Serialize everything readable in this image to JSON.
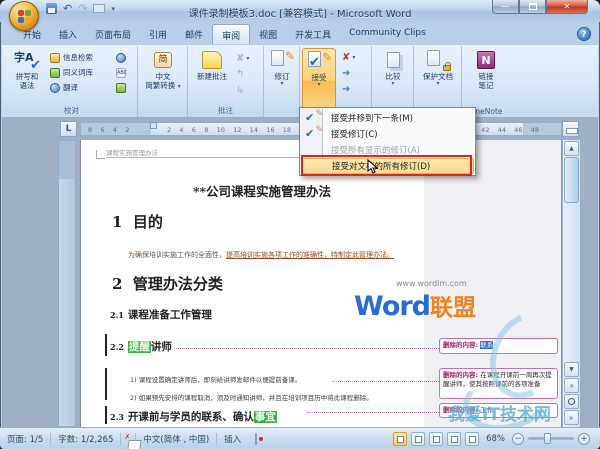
{
  "window": {
    "title": "课件录制模板3.doc [兼容模式] - Microsoft Word"
  },
  "tabs": [
    "开始",
    "插入",
    "页面布局",
    "引用",
    "邮件",
    "审阅",
    "视图",
    "开发工具",
    "Community Clips"
  ],
  "icons": {
    "spelling": "字A",
    "check": "✔",
    "pencil": "✎",
    "reject": "✘",
    "arrow": "➜",
    "chinese": "简",
    "onenote": "N",
    "help": "?",
    "undo": "↶",
    "redo": "↷",
    "min_glyph": "—",
    "close_glyph": "✕",
    "dropdown": "▾",
    "up": "▲",
    "down": "▼",
    "chevrons": "«",
    "minus": "−",
    "plus": "+"
  },
  "ribbon": {
    "spelling_line1": "拼写和",
    "spelling_line2": "语法",
    "research": "信息检索",
    "thesaurus": "同义词库",
    "translate": "翻译",
    "proofing_group": "校对",
    "chinese_line1": "中文",
    "chinese_line2": "简繁转换",
    "new_comment": "新建批注",
    "comments_group": "批注",
    "track_changes": "修订",
    "accept": "接受",
    "compare": "比较",
    "protect": "保护文档",
    "notes_line1": "链接",
    "notes_line2": "笔记",
    "onenote_group": "OneNote"
  },
  "accept_menu": {
    "items": [
      {
        "label": "接受并移到下一条(M)"
      },
      {
        "label": "接受修订(C)"
      },
      {
        "label": "接受所有显示的修订(A)"
      },
      {
        "label": "接受对文档的所有修订(D)"
      }
    ]
  },
  "ruler": {
    "left_numbers": "8    6    4    2",
    "right_numbers": "2    4    6    8    10    12    14    16    18    20    22    24    26    28    30    32    34    36    38    40    42    44    46    48"
  },
  "document": {
    "header": "课程实施管理办法",
    "title": "**公司课程实施管理办法",
    "h1_1": "1  目的",
    "p1_a": "为确保培训实施工作的全面性，",
    "p1_b": "提高培训实施各项工作的准确性，",
    "p1_c": "特制定此管理办法。",
    "h1_2": "2  管理办法分类",
    "h21_num": "2.1",
    "h21": "课程准备工作管理",
    "h22_num": "2.2",
    "h22_ins": "提醒",
    "h22": "讲师",
    "li1": "1) 课程设置确定讲师后，即刻给讲师发邮件以便提前备课。",
    "li2": "2) 如果预先安排的课程取消，须及时通知讲师，并且在培训项目历中将此课程删除。",
    "h23_num": "2.3",
    "h23": "开课前与学员的联系、确认",
    "h23_ins": "事宜"
  },
  "balloons": [
    {
      "label": "删除的内容:",
      "text": "联系"
    },
    {
      "label": "删除的内容:",
      "text": "在课程开课前一周再次提醒讲师，使其按照课前的各项准备"
    },
    {
      "label": "删除的内容:",
      "text": "工作"
    }
  ],
  "watermark": {
    "url": "www.wordlm.com",
    "brand_en": "Word",
    "brand_cn": "联盟"
  },
  "watermark2": "我爱IT技术网",
  "statusbar": {
    "page": "页面: 1/5",
    "words": "字数: 1/2,265",
    "language": "中文(简体 , 中国)",
    "mode": "插入",
    "zoom": "68%"
  },
  "colors": {
    "highlight_orange": "#fcd271",
    "annotation_red": "#e2241b",
    "balloon_border": "#c86fae",
    "inserted_green": "#3fae49",
    "watermark_blue": "#2b6bd4",
    "watermark_orange": "#f2821f"
  }
}
